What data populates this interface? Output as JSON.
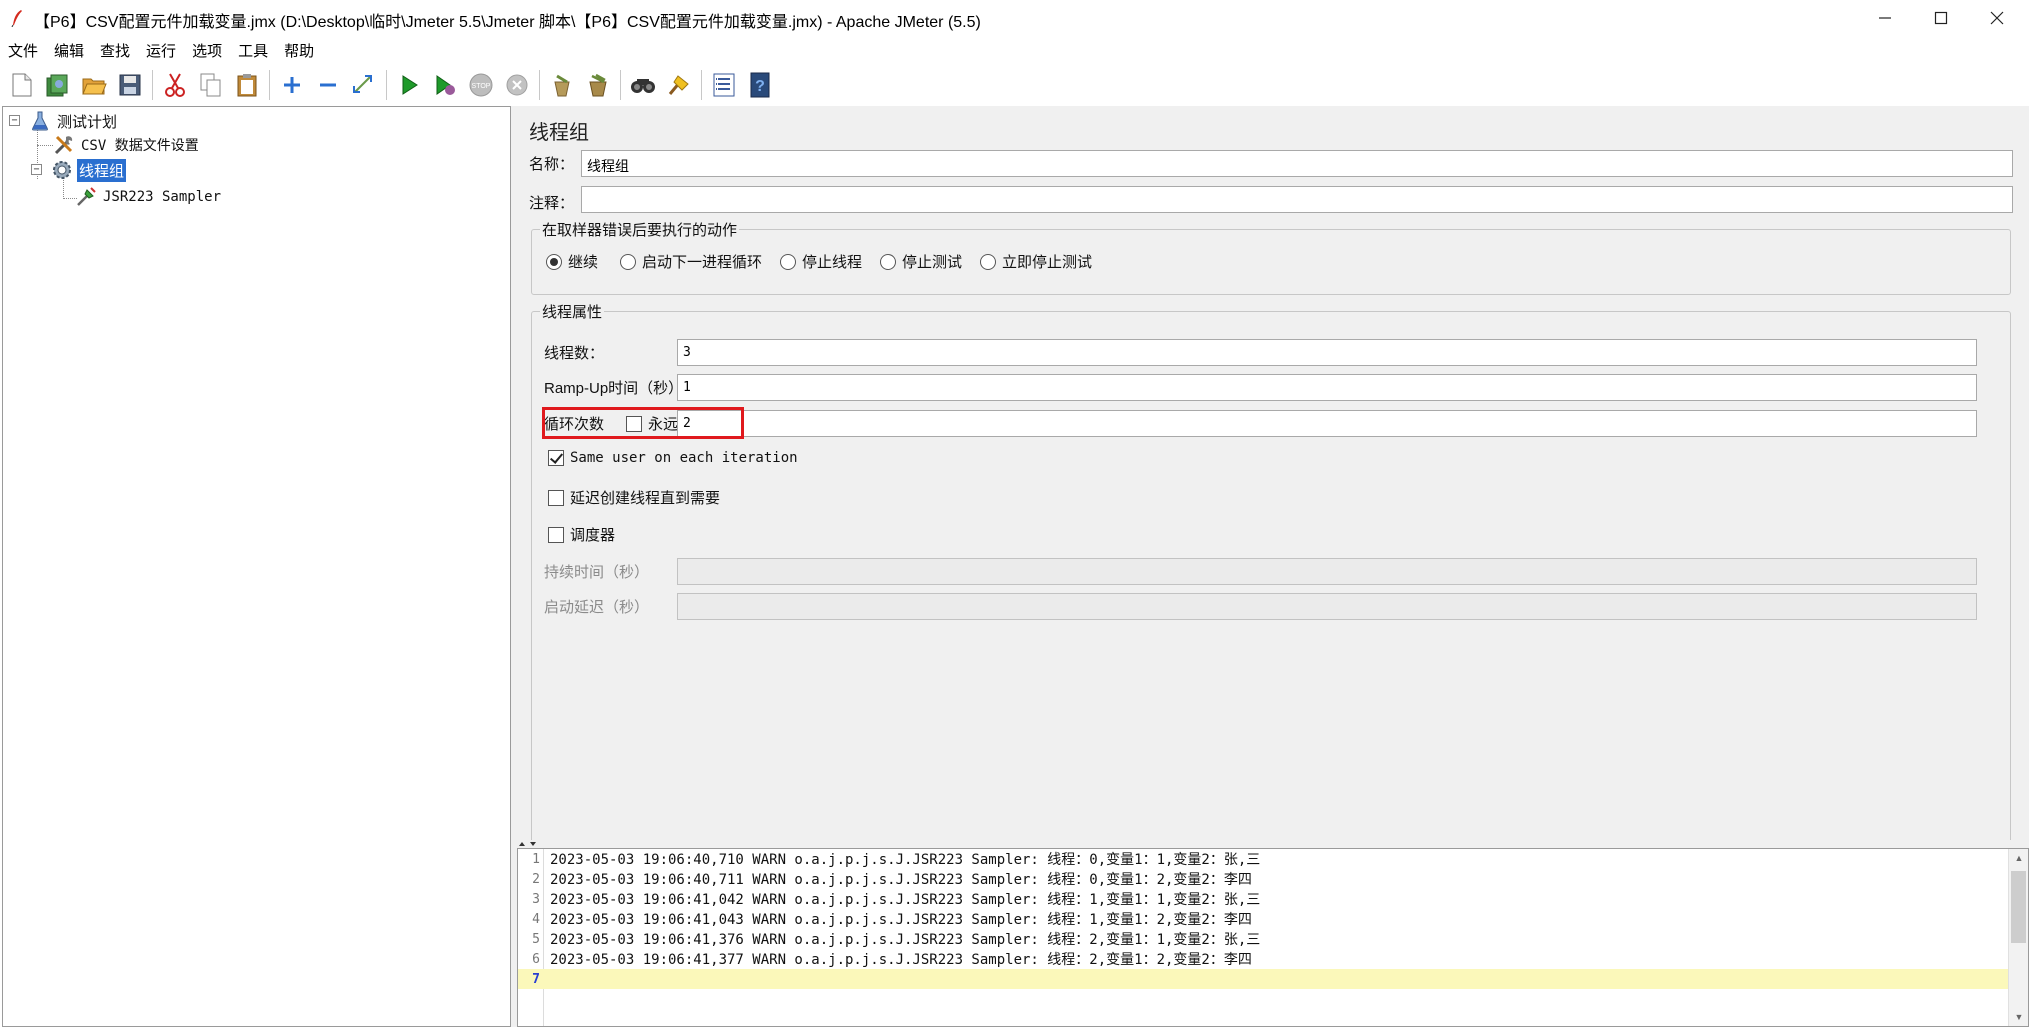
{
  "window": {
    "title": "【P6】CSV配置元件加载变量.jmx (D:\\Desktop\\临时\\Jmeter 5.5\\Jmeter 脚本\\【P6】CSV配置元件加载变量.jmx) - Apache JMeter (5.5)",
    "controls": [
      "minimize",
      "maximize",
      "close"
    ]
  },
  "menu": [
    "文件",
    "编辑",
    "查找",
    "运行",
    "选项",
    "工具",
    "帮助"
  ],
  "toolbar": {
    "buttons": [
      {
        "name": "new-icon"
      },
      {
        "name": "templates-icon"
      },
      {
        "name": "open-icon"
      },
      {
        "name": "save-icon"
      },
      {
        "name": "cut-icon"
      },
      {
        "name": "copy-icon"
      },
      {
        "name": "paste-icon"
      },
      {
        "name": "expand-icon"
      },
      {
        "name": "collapse-icon"
      },
      {
        "name": "toggle-icon"
      },
      {
        "name": "start-icon"
      },
      {
        "name": "start-no-pause-icon"
      },
      {
        "name": "stop-icon"
      },
      {
        "name": "shutdown-icon"
      },
      {
        "name": "clear-icon"
      },
      {
        "name": "clear-all-icon"
      },
      {
        "name": "search-icon"
      },
      {
        "name": "reset-search-icon"
      },
      {
        "name": "function-helper-icon"
      },
      {
        "name": "help-icon"
      }
    ]
  },
  "tree": {
    "items": [
      {
        "label": "测试计划",
        "icon": "test-plan-icon",
        "level": 0,
        "expanded": true
      },
      {
        "label": "CSV 数据文件设置",
        "icon": "config-element-icon",
        "level": 1
      },
      {
        "label": "线程组",
        "icon": "thread-group-icon",
        "level": 1,
        "expanded": true,
        "selected": true
      },
      {
        "label": "JSR223 Sampler",
        "icon": "sampler-icon",
        "level": 2
      }
    ]
  },
  "panel": {
    "title": "线程组",
    "name_label": "名称：",
    "name_value": "线程组",
    "comment_label": "注释：",
    "comment_value": "",
    "error_action": {
      "legend": "在取样器错误后要执行的动作",
      "options": [
        "继续",
        "启动下一进程循环",
        "停止线程",
        "停止测试",
        "立即停止测试"
      ],
      "selected": "继续"
    },
    "thread_props": {
      "legend": "线程属性",
      "threads_label": "线程数：",
      "threads_value": "3",
      "rampup_label": "Ramp-Up时间（秒）：",
      "rampup_value": "1",
      "loop_label": "循环次数",
      "forever_label": "永远",
      "forever_checked": false,
      "loop_value": "2",
      "same_user_label": "Same user on each iteration",
      "same_user_checked": true,
      "delay_label": "延迟创建线程直到需要",
      "delay_checked": false,
      "scheduler_label": "调度器",
      "scheduler_checked": false,
      "duration_label": "持续时间（秒）",
      "duration_value": "",
      "startup_delay_label": "启动延迟（秒）",
      "startup_delay_value": ""
    }
  },
  "log": {
    "lines": [
      {
        "num": "1",
        "text": "2023-05-03 19:06:40,710 WARN o.a.j.p.j.s.J.JSR223 Sampler: 线程：0,变量1：1,变量2：张,三"
      },
      {
        "num": "2",
        "text": "2023-05-03 19:06:40,711 WARN o.a.j.p.j.s.J.JSR223 Sampler: 线程：0,变量1：2,变量2：李四"
      },
      {
        "num": "3",
        "text": "2023-05-03 19:06:41,042 WARN o.a.j.p.j.s.J.JSR223 Sampler: 线程：1,变量1：1,变量2：张,三"
      },
      {
        "num": "4",
        "text": "2023-05-03 19:06:41,043 WARN o.a.j.p.j.s.J.JSR223 Sampler: 线程：1,变量1：2,变量2：李四"
      },
      {
        "num": "5",
        "text": "2023-05-03 19:06:41,376 WARN o.a.j.p.j.s.J.JSR223 Sampler: 线程：2,变量1：1,变量2：张,三"
      },
      {
        "num": "6",
        "text": "2023-05-03 19:06:41,377 WARN o.a.j.p.j.s.J.JSR223 Sampler: 线程：2,变量1：2,变量2：李四"
      },
      {
        "num": "7",
        "text": ""
      }
    ],
    "current_line": "7"
  },
  "colors": {
    "selection": "#2a6fd0",
    "highlight_border": "#e0191d",
    "current_line_bg": "#fbf8ba",
    "panel_bg": "#f0f0f0"
  }
}
